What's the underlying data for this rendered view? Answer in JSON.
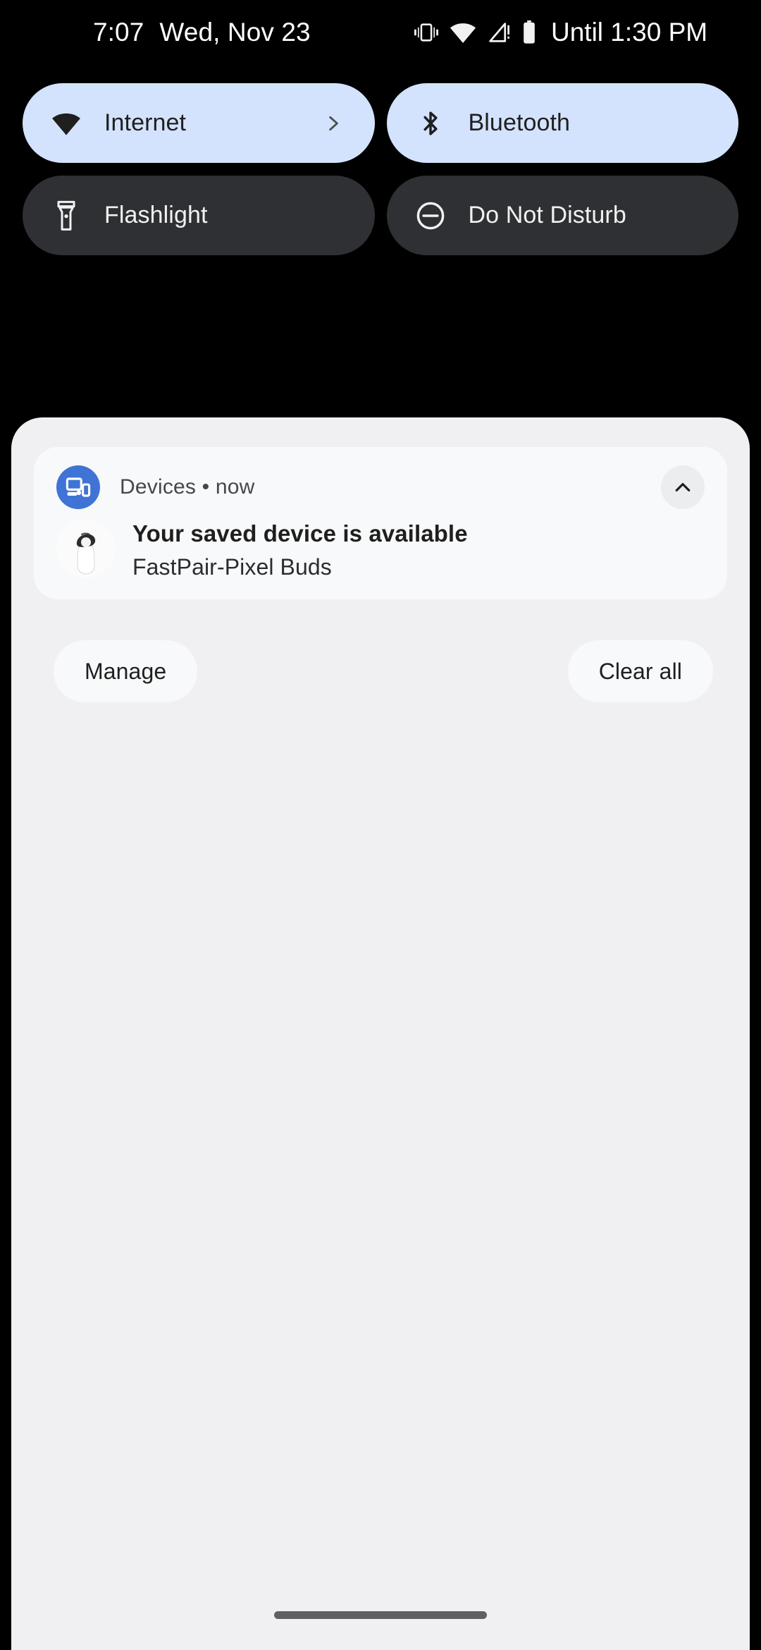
{
  "status_bar": {
    "time": "7:07",
    "date": "Wed, Nov 23",
    "icons": [
      "vibrate-icon",
      "wifi-icon",
      "no-signal-icon",
      "battery-icon"
    ],
    "battery_estimate": "Until 1:30 PM"
  },
  "quick_settings": {
    "tiles": [
      {
        "label": "Internet",
        "icon": "wifi-icon",
        "state": "active",
        "has_chevron": true,
        "chevron": "chevron-right-icon"
      },
      {
        "label": "Bluetooth",
        "icon": "bluetooth-icon",
        "state": "active",
        "has_chevron": false,
        "chevron": ""
      },
      {
        "label": "Flashlight",
        "icon": "flashlight-icon",
        "state": "inactive",
        "has_chevron": false,
        "chevron": ""
      },
      {
        "label": "Do Not Disturb",
        "icon": "do-not-disturb-icon",
        "state": "inactive",
        "has_chevron": false,
        "chevron": ""
      }
    ]
  },
  "notification_shade": {
    "notification": {
      "app_icon": "devices-icon",
      "app_name": "Devices",
      "separator": "•",
      "timestamp": "now",
      "header_text": "Devices • now",
      "collapse_icon": "chevron-up-icon",
      "thumbnail": "pixel-buds-earbud-image",
      "title": "Your saved device is available",
      "subtitle": "FastPair-Pixel Buds"
    },
    "footer": {
      "manage_label": "Manage",
      "clear_all_label": "Clear all"
    }
  },
  "colors": {
    "background": "#000000",
    "tile_active_bg": "#d3e3fd",
    "tile_active_fg": "#1f1f1f",
    "tile_inactive_bg": "#2f3033",
    "tile_inactive_fg": "#f1f1f1",
    "shade_bg": "#f0f0f2",
    "card_bg": "#f8f9fa",
    "app_icon_blue": "#3f73d6",
    "home_indicator": "#5f6062"
  }
}
